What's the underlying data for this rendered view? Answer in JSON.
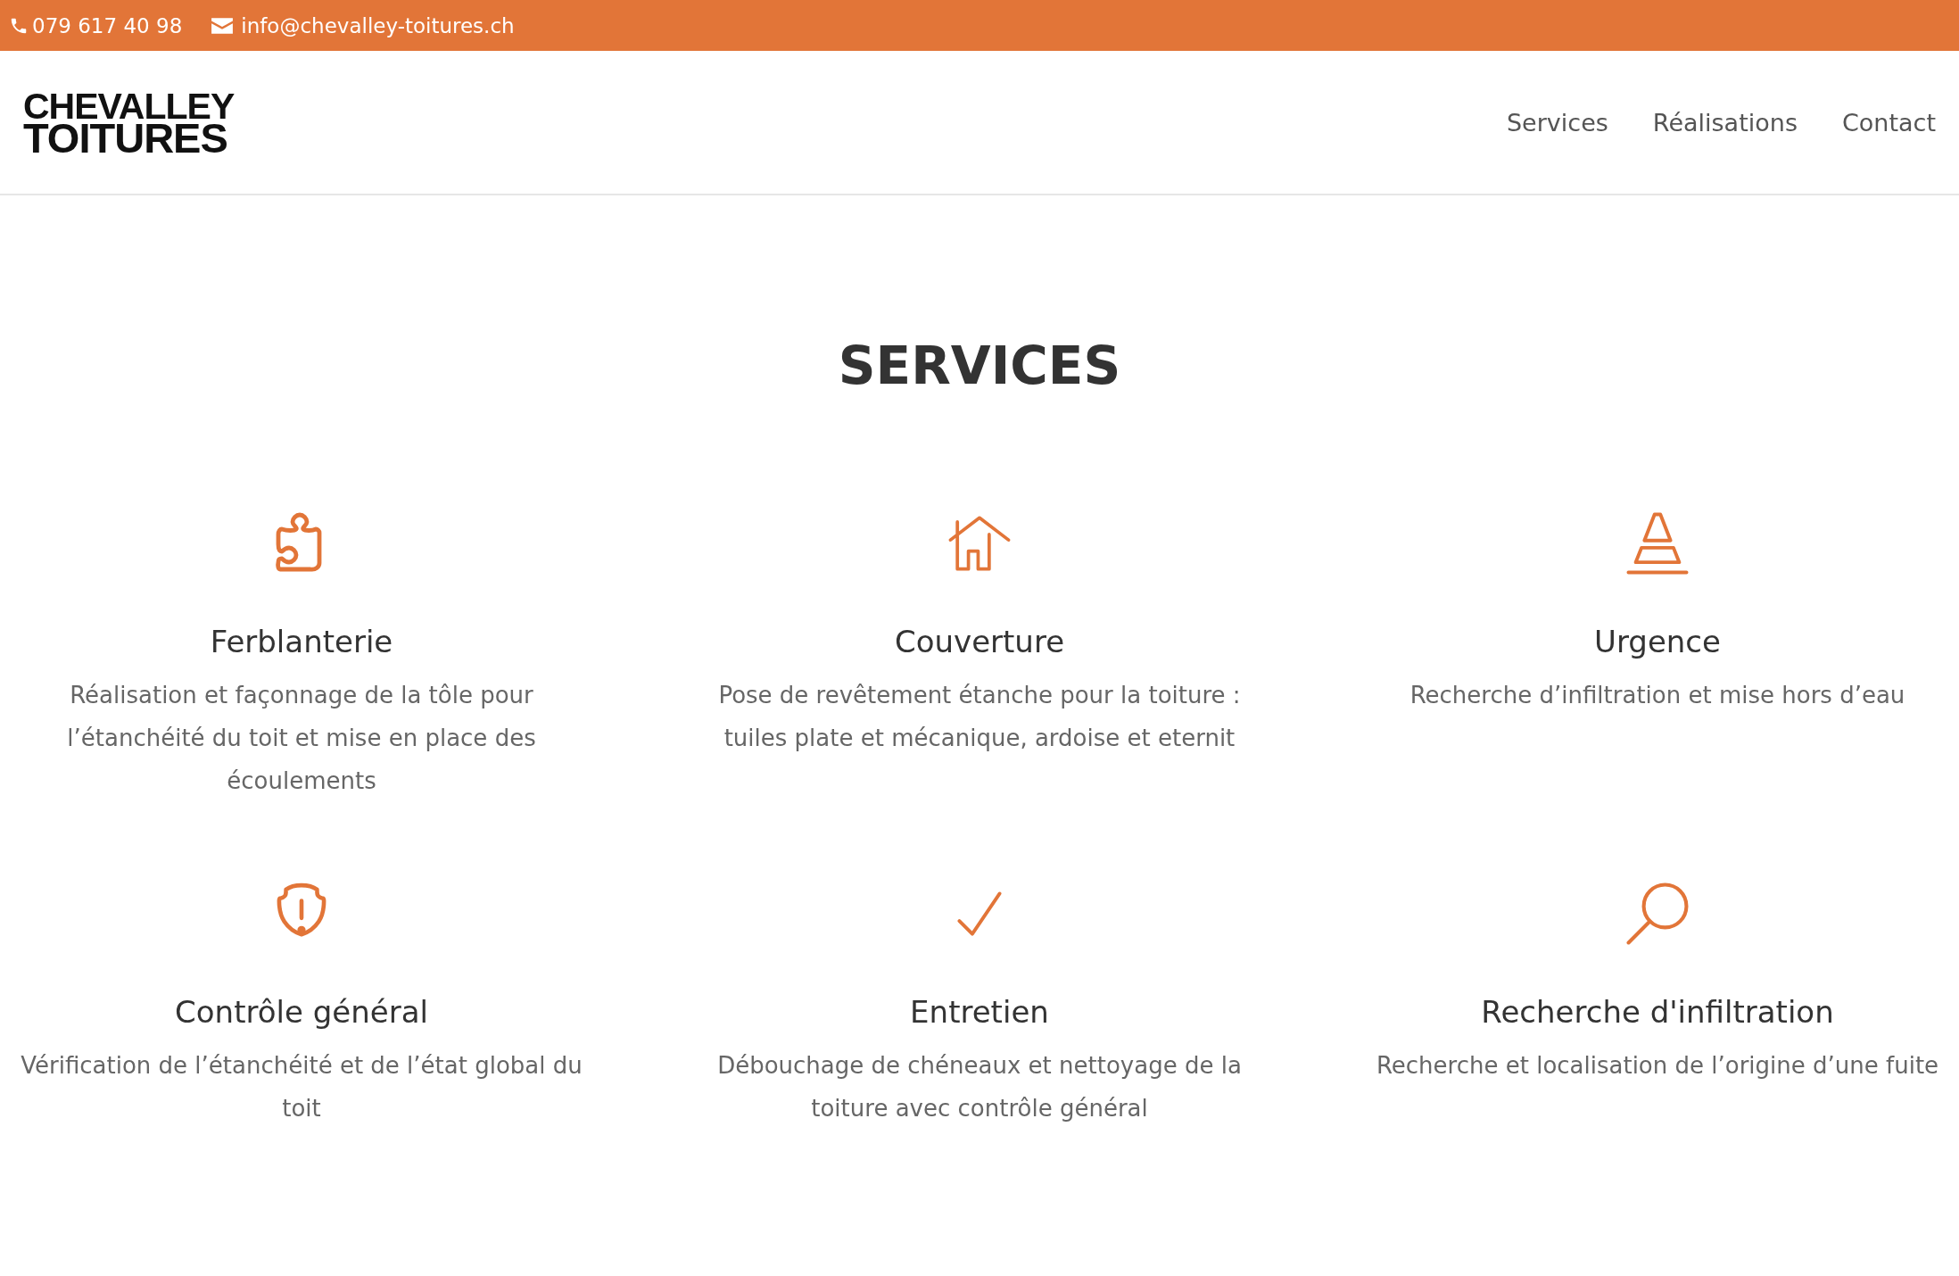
{
  "top_bar": {
    "phone": "079 617 40 98",
    "email": "info@chevalley-toitures.ch"
  },
  "header": {
    "logo": [
      "CHEVALLEY",
      "TOITURES"
    ],
    "nav": [
      {
        "label": "Services",
        "selected": false
      },
      {
        "label": "Réalisations",
        "selected": false
      },
      {
        "label": "Contact",
        "selected": false
      }
    ]
  },
  "section": {
    "title": "SERVICES",
    "services": [
      {
        "kind": "puzzle",
        "title": "Ferblanterie",
        "description": "Réalisation et façonnage de la tôle pour l’étanchéité du toit et mise en place des écoulements"
      },
      {
        "kind": "house",
        "title": "Couverture",
        "description": "Pose de revêtement étanche pour la toiture : tuiles plate et mécanique, ardoise et eternit"
      },
      {
        "kind": "cone",
        "title": "Urgence",
        "description": "Recherche d’infiltration et mise hors d’eau"
      },
      {
        "kind": "shield",
        "title": "Contrôle général",
        "description": "Vérification de l’étanchéité et de l’état global du toit"
      },
      {
        "kind": "check",
        "title": "Entretien",
        "description": "Débouchage de chéneaux et nettoyage de la toiture avec contrôle général"
      },
      {
        "kind": "magnifier",
        "title": "Recherche d'infiltration",
        "description": "Recherche et localisation de l’origine d’une fuite"
      }
    ]
  }
}
